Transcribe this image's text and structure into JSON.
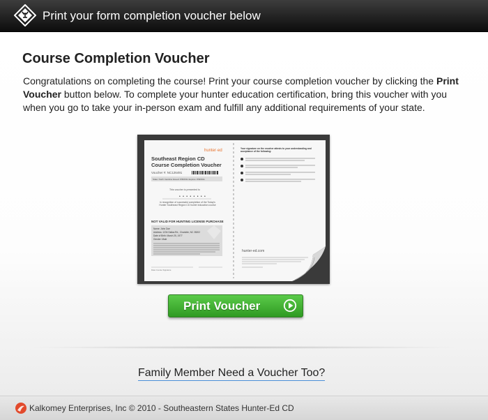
{
  "header": {
    "title": "Print your form completion voucher below",
    "logo_icon": "deer-diamond-icon"
  },
  "main": {
    "page_title": "Course Completion Voucher",
    "intro_part1": "Congratulations on completing the course!  Print your course completion voucher by clicking the ",
    "intro_bold": "Print Voucher",
    "intro_part2": " button below.  To complete your hunter education certification, bring this voucher with you when you go to take your in-person exam and fulfill any additional requirements of your state.",
    "print_button_label": "Print Voucher",
    "print_button_icon": "play-circle-icon",
    "family_link": "Family Member Need a Voucher Too?"
  },
  "voucher_preview": {
    "brand": "hunter·ed",
    "title_line1": "Southeast Region CD",
    "title_line2": "Course Completion Voucher",
    "voucher_number": "Voucher #: NC126491",
    "state_row": "State: North Carolina   Issued: 8/8/2011   Expires: 8/8/2011",
    "presented_to": "This voucher is presented to",
    "recognition": "in recognition of successful completion of the Today's Hunter Southeast Region CD hunter education course",
    "not_valid": "NOT VALID FOR HUNTING LICENSE PURCHASE",
    "name": "Name: John Doe",
    "address": "Address: 1234 Dallas Rd., Charlotte, NC 28202",
    "dob": "Date of Birth: March 25, 1977",
    "gender": "Gender: Male",
    "sign_label": "Date Course Signature",
    "right_heading": "Your signature on the voucher attests to your understanding and acceptance of the following:",
    "footer_brand": "hunter-ed.com",
    "colors": {
      "accent": "#e8702a",
      "button_green": "#3fae30"
    }
  },
  "footer": {
    "text": "Kalkomey Enterprises, Inc © 2010 - Southeastern States Hunter-Ed CD",
    "logo_icon": "kalkomey-logo-icon"
  }
}
